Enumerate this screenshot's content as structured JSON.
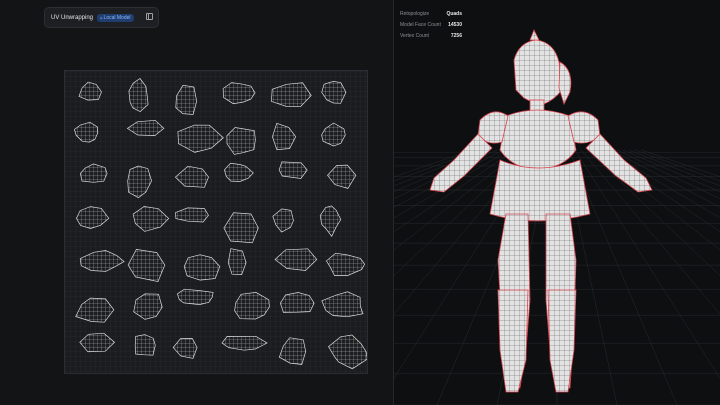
{
  "toolbar": {
    "title": "UV Unwrapping",
    "badge_label": "Local Model",
    "badge_icon": "cube-icon"
  },
  "stats": [
    {
      "label": "Retopologize",
      "value": "Quads"
    },
    {
      "label": "Model Face Count",
      "value": "14530"
    },
    {
      "label": "Vertex Count",
      "value": "7256"
    }
  ],
  "colors": {
    "accent": "#8fb6ff",
    "badge_bg": "#1f3d6e",
    "seam": "#d8434d",
    "mesh": "#e7e7e7",
    "wire": "#2a2a2a"
  }
}
